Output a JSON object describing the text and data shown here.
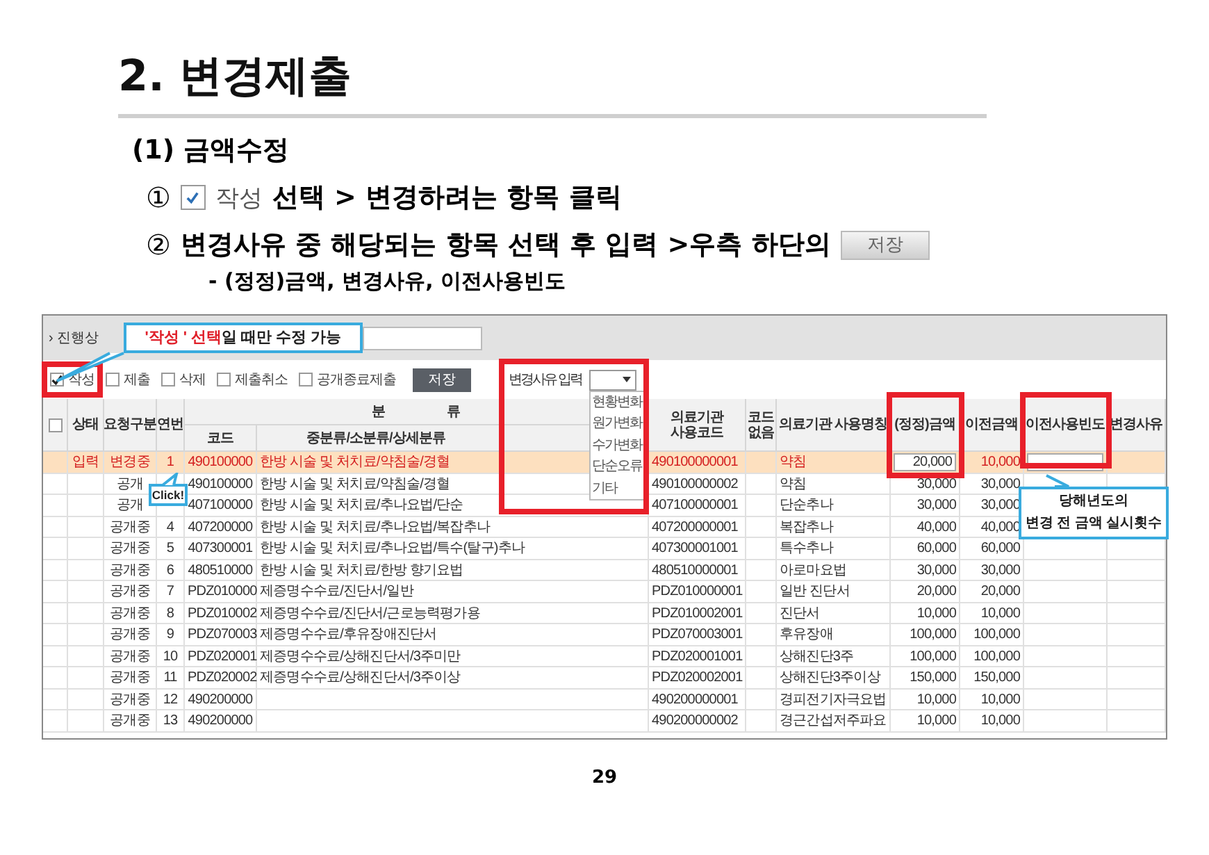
{
  "heading": "2. 변경제출",
  "subheading": "(1) 금액수정",
  "steps": [
    {
      "marker": "①",
      "checkbox": {
        "checked": true,
        "label": "작성"
      },
      "text": "선택 > 변경하려는 항목 클릭"
    },
    {
      "marker": "②",
      "text": "변경사유 중 해당되는 항목 선택 후 입력 >우측 하단의",
      "button": "저장"
    }
  ],
  "note": "- (정정)금액, 변경사유, 이전사용빈도",
  "app": {
    "breadcrumb": "› 진행상",
    "filters": [
      {
        "label": "작성",
        "checked": true
      },
      {
        "label": "제출",
        "checked": false
      },
      {
        "label": "삭제",
        "checked": false
      },
      {
        "label": "제출취소",
        "checked": false
      },
      {
        "label": "공개종료제출",
        "checked": false
      }
    ],
    "save_button": "저장",
    "reason_label": "변경사유 입력",
    "reason_options": [
      "현황변화",
      "원가변화",
      "수가변화",
      "단순오류",
      "기타"
    ],
    "columns": [
      {
        "kind": "checkbox",
        "checked": false
      },
      {
        "kind": "text",
        "label": "상태"
      },
      {
        "kind": "text",
        "label": "요청구분"
      },
      {
        "kind": "text",
        "label": "연번"
      },
      {
        "kind": "group",
        "label": "분류",
        "children": [
          "코드",
          "중분류/소분류/상세분류"
        ]
      },
      {
        "kind": "text",
        "label": "의료기관 사용코드"
      },
      {
        "kind": "text",
        "label": "코드 없음"
      },
      {
        "kind": "text",
        "label": "의료기관 사용명칭"
      },
      {
        "kind": "text",
        "label": "(정정)금액"
      },
      {
        "kind": "text",
        "label": "이전금액"
      },
      {
        "kind": "text",
        "label": "이전사용빈도"
      },
      {
        "kind": "text",
        "label": "변경사유"
      }
    ],
    "rows": [
      {
        "selected": true,
        "status": "입력",
        "request": "변경중",
        "no": "1",
        "code": "490100000",
        "category": "한방 시술 및 처치료/약침술/경혈",
        "inst_code": "490100000001",
        "inst_name": "약침",
        "amount": "20,000",
        "prev_amount": "10,000"
      },
      {
        "selected": false,
        "request": "공개",
        "code": "490100000",
        "category": "한방 시술 및 처치료/약침술/경혈",
        "inst_code": "490100000002",
        "inst_name": "약침",
        "amount": "30,000",
        "prev_amount": "30,000"
      },
      {
        "selected": false,
        "request": "공개",
        "code": "407100000",
        "category": "한방 시술 및 처치료/추나요법/단순",
        "inst_code": "407100000001",
        "inst_name": "단순추나",
        "amount": "30,000",
        "prev_amount": "30,000"
      },
      {
        "selected": false,
        "request": "공개중",
        "no": "4",
        "code": "407200000",
        "category": "한방 시술 및 처치료/추나요법/복잡추나",
        "inst_code": "407200000001",
        "inst_name": "복잡추나",
        "amount": "40,000",
        "prev_amount": "40,000"
      },
      {
        "selected": false,
        "request": "공개중",
        "no": "5",
        "code": "407300001",
        "category": "한방 시술 및 처치료/추나요법/특수(탈구)추나",
        "inst_code": "407300001001",
        "inst_name": "특수추나",
        "amount": "60,000",
        "prev_amount": "60,000"
      },
      {
        "selected": false,
        "request": "공개중",
        "no": "6",
        "code": "480510000",
        "category": "한방 시술 및 처치료/한방 향기요법",
        "inst_code": "480510000001",
        "inst_name": "아로마요법",
        "amount": "30,000",
        "prev_amount": "30,000"
      },
      {
        "selected": false,
        "request": "공개중",
        "no": "7",
        "code": "PDZ010000",
        "category": "제증명수수료/진단서/일반",
        "inst_code": "PDZ010000001",
        "inst_name": "일반 진단서",
        "amount": "20,000",
        "prev_amount": "20,000"
      },
      {
        "selected": false,
        "request": "공개중",
        "no": "8",
        "code": "PDZ010002",
        "category": "제증명수수료/진단서/근로능력평가용",
        "inst_code": "PDZ010002001",
        "inst_name": "진단서",
        "amount": "10,000",
        "prev_amount": "10,000"
      },
      {
        "selected": false,
        "request": "공개중",
        "no": "9",
        "code": "PDZ070003",
        "category": "제증명수수료/후유장애진단서",
        "inst_code": "PDZ070003001",
        "inst_name": "후유장애",
        "amount": "100,000",
        "prev_amount": "100,000"
      },
      {
        "selected": false,
        "request": "공개중",
        "no": "10",
        "code": "PDZ020001",
        "category": "제증명수수료/상해진단서/3주미만",
        "inst_code": "PDZ020001001",
        "inst_name": "상해진단3주",
        "amount": "100,000",
        "prev_amount": "100,000"
      },
      {
        "selected": false,
        "request": "공개중",
        "no": "11",
        "code": "PDZ020002",
        "category": "제증명수수료/상해진단서/3주이상",
        "inst_code": "PDZ020002001",
        "inst_name": "상해진단3주이상",
        "amount": "150,000",
        "prev_amount": "150,000"
      },
      {
        "selected": false,
        "request": "공개중",
        "no": "12",
        "code": "490200000",
        "inst_code": "490200000001",
        "inst_name": "경피전기자극요법",
        "amount": "10,000",
        "prev_amount": "10,000"
      },
      {
        "selected": false,
        "request": "공개중",
        "no": "13",
        "code": "490200000",
        "inst_code": "490200000002",
        "inst_name": "경근간섭저주파요",
        "amount": "10,000",
        "prev_amount": "10,000"
      }
    ],
    "callouts": [
      {
        "kind": "filter",
        "emphasis": "'작성 ' 선택",
        "text": "일 때만 수정 가능"
      },
      {
        "kind": "row",
        "text": "Click!"
      },
      {
        "kind": "usage",
        "lines": [
          "당해년도의",
          "변경 전 금액 실시횟수"
        ]
      }
    ]
  },
  "page_number": "29"
}
